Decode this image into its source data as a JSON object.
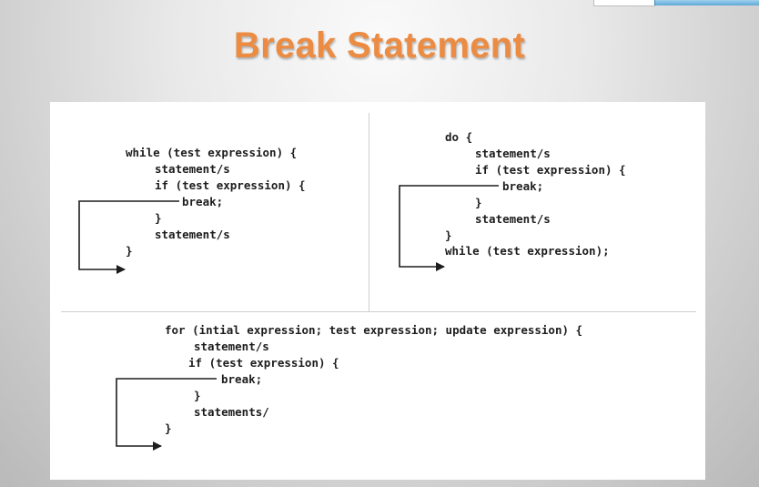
{
  "title": "Break Statement",
  "while_block": {
    "lines": [
      "while (test expression) {",
      "statement/s",
      "if (test expression) {",
      "break;",
      "}",
      "statement/s",
      "}"
    ]
  },
  "do_block": {
    "lines": [
      "do {",
      "statement/s",
      "if (test expression) {",
      "break;",
      "}",
      "statement/s",
      "}",
      "while (test expression);"
    ]
  },
  "for_block": {
    "lines": [
      "for (intial expression; test expression; update expression) {",
      "statement/s",
      "if (test expression) {",
      "break;",
      "}",
      "statements/",
      "}"
    ]
  }
}
